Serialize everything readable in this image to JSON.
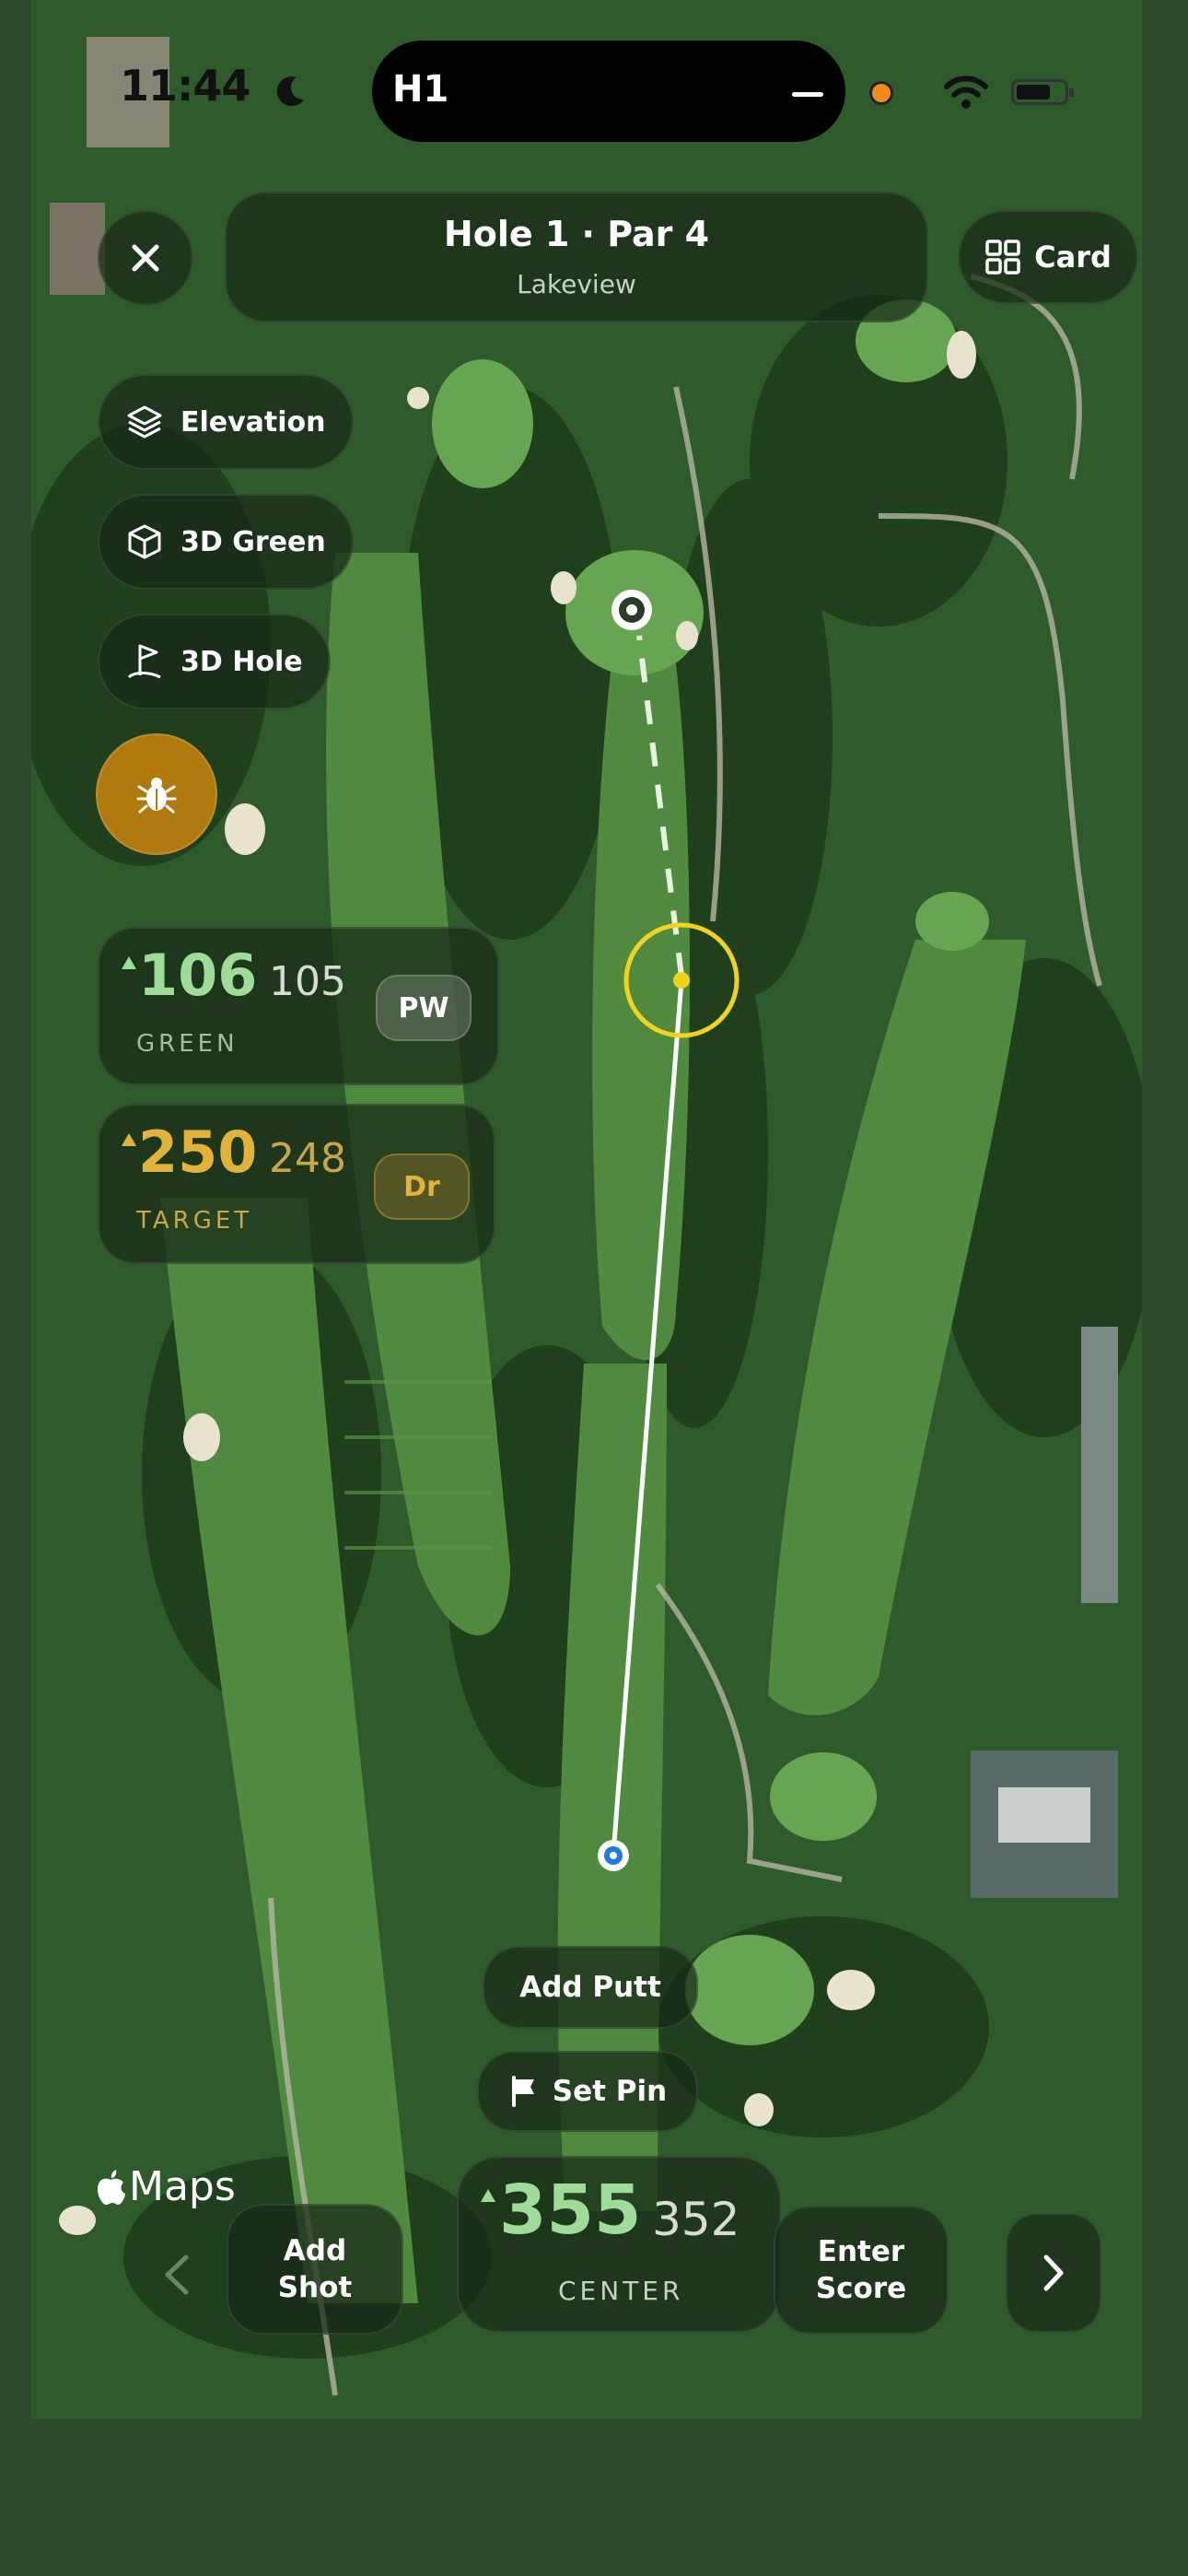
{
  "status": {
    "time": "11:44",
    "island_label": "H1"
  },
  "hole": {
    "title": "Hole 1  ·  Par 4",
    "course": "Lakeview"
  },
  "card_button": {
    "label": "Card"
  },
  "layers": [
    {
      "label": "Elevation",
      "icon": "layers-icon"
    },
    {
      "label": "3D Green",
      "icon": "cube-icon"
    },
    {
      "label": "3D Hole",
      "icon": "flag-outline-icon"
    }
  ],
  "green": {
    "distance": "106",
    "adjusted": "105",
    "label": "GREEN",
    "club": "PW"
  },
  "target": {
    "distance": "250",
    "adjusted": "248",
    "label": "TARGET",
    "club": "Dr"
  },
  "actions": {
    "add_putt": "Add Putt",
    "set_pin": "Set Pin"
  },
  "bottom": {
    "add_shot": "Add\nShot",
    "center_distance": "355",
    "center_adjusted": "352",
    "center_label": "CENTER",
    "enter_score": "Enter\nScore"
  },
  "attribution": {
    "maps": "Maps"
  },
  "colors": {
    "green_accent": "#9fdc9a",
    "target_accent": "#e2b33a",
    "target_ring": "#f2d21c",
    "bug_button": "#b07a0e",
    "shot_line": "#ffffff",
    "player_dot": "#1f7be0"
  }
}
